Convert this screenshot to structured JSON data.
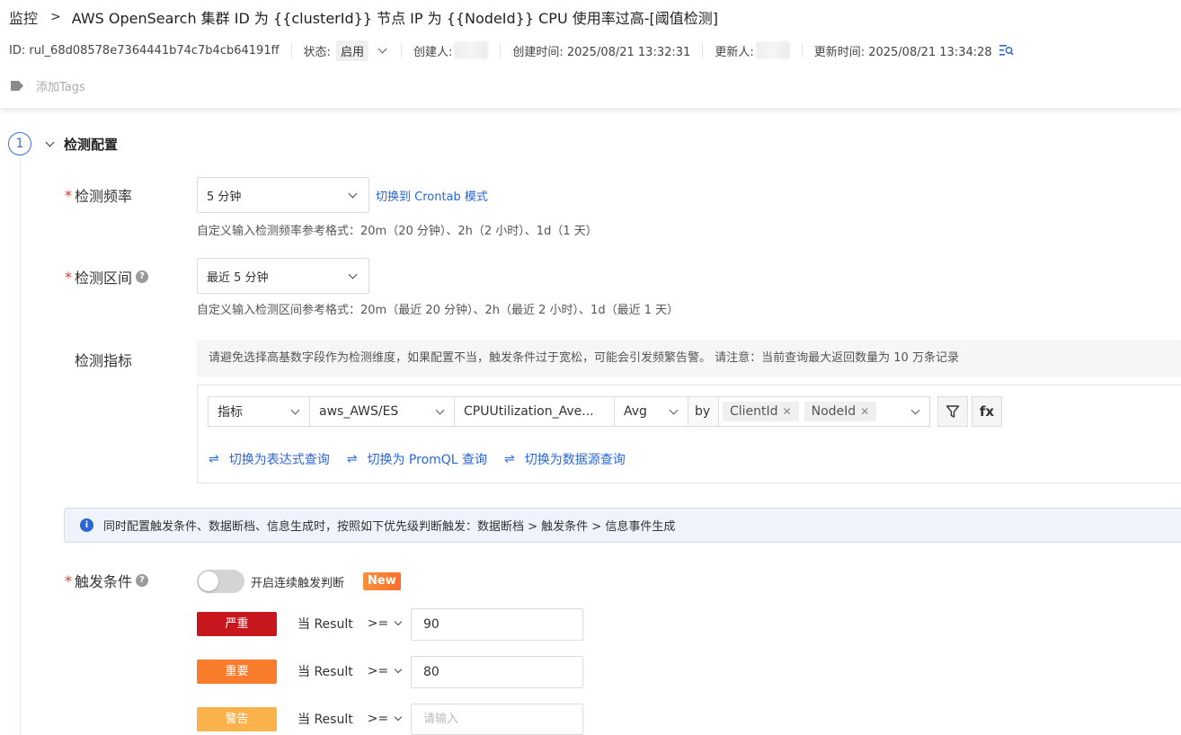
{
  "header": {
    "breadcrumb_root": "监控",
    "title": "AWS OpenSearch 集群 ID 为 {{clusterId}} 节点 IP 为 {{NodeId}} CPU 使用率过高-[阈值检测]",
    "id_text": "ID: rul_68d08578e7364441b74c7b4cb64191ff",
    "status_label": "状态:",
    "status_value": "启用",
    "creator_label": "创建人:",
    "created_time": "创建时间: 2025/08/21 13:32:31",
    "updater_label": "更新人:",
    "updated_time": "更新时间: 2025/08/21 13:34:28",
    "add_tags": "添加Tags"
  },
  "section": {
    "step": "1",
    "title": "检测配置"
  },
  "frequency": {
    "label": "检测频率",
    "value": "5 分钟",
    "switch_link": "切换到 Crontab 模式",
    "hint": "自定义输入检测频率参考格式：20m（20 分钟）、2h（2 小时）、1d（1 天）"
  },
  "interval": {
    "label": "检测区间",
    "value": "最近 5 分钟",
    "hint": "自定义输入检测区间参考格式：20m（最近 20 分钟）、2h（最近 2 小时）、1d（最近 1 天）"
  },
  "metric": {
    "label": "检测指标",
    "notice": "请避免选择高基数字段作为检测维度，如果配置不当，触发条件过于宽松，可能会引发频繁告警。 请注意：当前查询最大返回数量为 10 万条记录",
    "type": "指标",
    "namespace": "aws_AWS/ES",
    "metric_name": "CPUUtilization_Ave...",
    "aggregation": "Avg",
    "by_label": "by",
    "group_by": [
      "ClientId",
      "NodeId"
    ],
    "fx_label": "fx",
    "switch_links": [
      "切换为表达式查询",
      "切换为 PromQL 查询",
      "切换为数据源查询"
    ]
  },
  "info_bar": "同时配置触发条件、数据断档、信息生成时，按照如下优先级判断触发：数据断档 > 触发条件 > 信息事件生成",
  "trigger": {
    "label": "触发条件",
    "toggle_label": "开启连续触发判断",
    "new_badge": "New",
    "levels": [
      {
        "name": "严重",
        "cond": "当 Result",
        "op": ">=",
        "value": "90",
        "color": "#c8161d"
      },
      {
        "name": "重要",
        "cond": "当 Result",
        "op": ">=",
        "value": "80",
        "color": "#f97b2c"
      },
      {
        "name": "警告",
        "cond": "当 Result",
        "op": ">=",
        "placeholder": "请输入",
        "color": "#fbb24b"
      }
    ]
  }
}
